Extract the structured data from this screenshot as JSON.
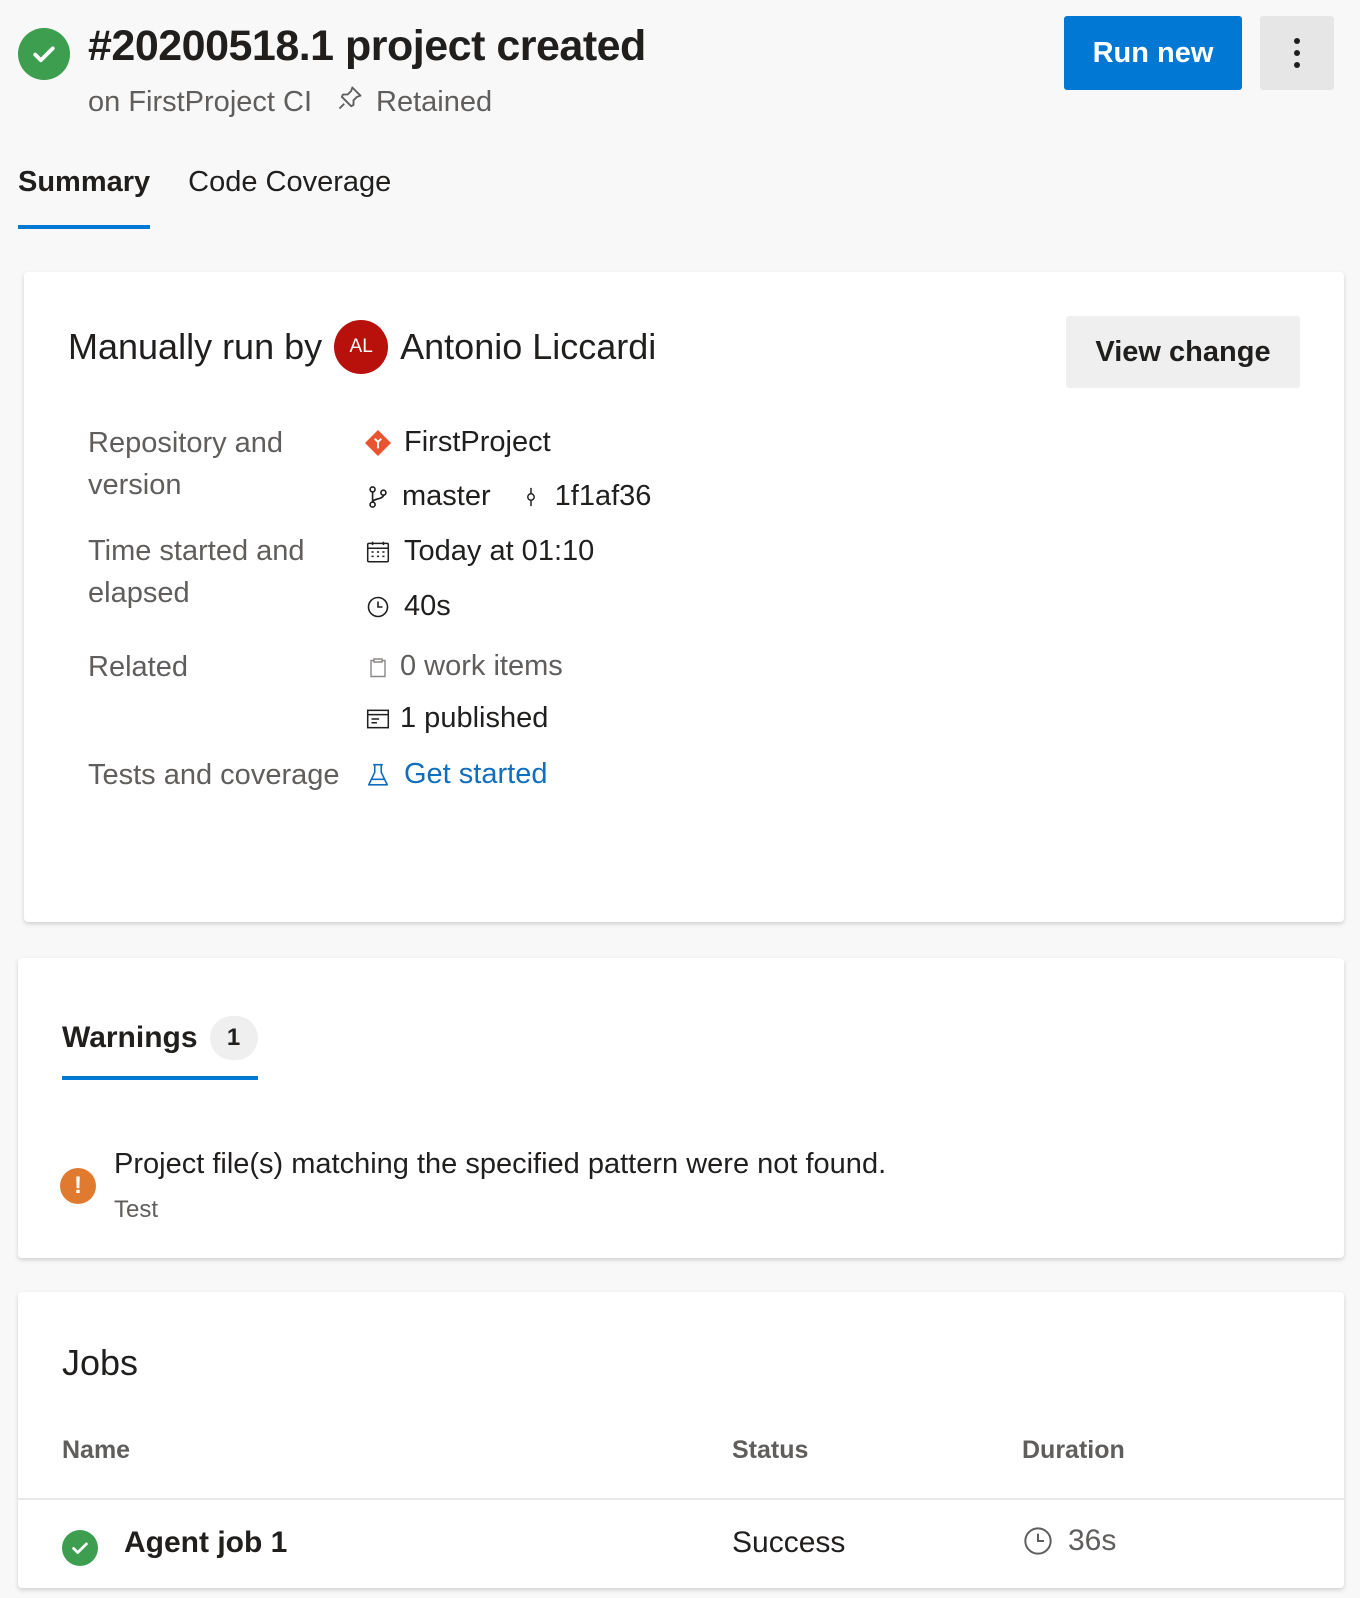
{
  "header": {
    "title": "#20200518.1 project created",
    "pipeline": "on FirstProject CI",
    "retained": "Retained",
    "run_new_label": "Run new",
    "status_color": "#3e9e50",
    "accent": "#0078d4"
  },
  "tabs": [
    {
      "label": "Summary",
      "active": true
    },
    {
      "label": "Code Coverage",
      "active": false
    }
  ],
  "summary": {
    "run_by_prefix": "Manually run by",
    "avatar_initials": "AL",
    "user_name": "Antonio Liccardi",
    "view_change_label": "View change",
    "labels": {
      "repository": "Repository and version",
      "time": "Time started and elapsed",
      "related": "Related",
      "tests": "Tests and coverage"
    },
    "repository": "FirstProject",
    "branch": "master",
    "commit": "1f1af36",
    "started": "Today at 01:10",
    "elapsed": "40s",
    "work_items": "0 work items",
    "published": "1 published",
    "tests_link": "Get started"
  },
  "warnings": {
    "tab_label": "Warnings",
    "count": "1",
    "message": "Project file(s) matching the specified pattern were not found.",
    "source": "Test",
    "icon_color": "#e07a2f"
  },
  "jobs": {
    "title": "Jobs",
    "columns": {
      "name": "Name",
      "status": "Status",
      "duration": "Duration"
    },
    "rows": [
      {
        "name": "Agent job 1",
        "status": "Success",
        "duration": "36s"
      }
    ]
  }
}
